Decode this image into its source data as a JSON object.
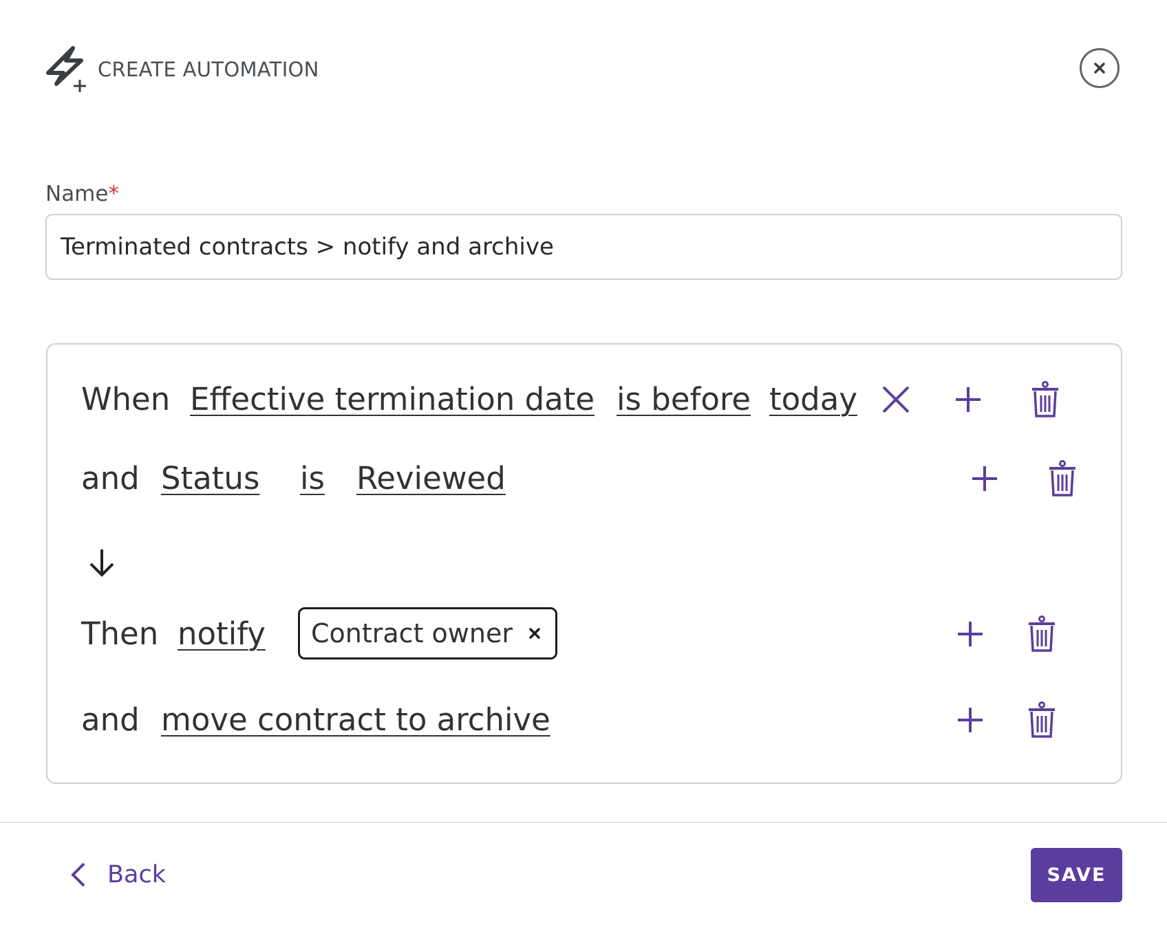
{
  "header": {
    "title": "CREATE AUTOMATION",
    "title_icon": "lightning-plus-icon",
    "close_icon": "close-icon"
  },
  "name_field": {
    "label": "Name",
    "required_mark": "*",
    "value": "Terminated contracts > notify and archive"
  },
  "conditions": [
    {
      "keyword": "When",
      "field": "Effective termination date",
      "operator": "is before",
      "value": "today",
      "has_clear": true
    },
    {
      "keyword": "and",
      "field": "Status",
      "operator": "is",
      "value": "Reviewed",
      "has_clear": false
    }
  ],
  "actions": [
    {
      "keyword": "Then",
      "action": "notify",
      "recipients": [
        "Contract owner"
      ]
    },
    {
      "keyword": "and",
      "action": "move contract to archive"
    }
  ],
  "icons": {
    "add": "plus-icon",
    "delete": "trash-icon",
    "clear": "x-icon",
    "flow": "arrow-down-icon",
    "back": "chevron-left-icon"
  },
  "footer": {
    "back_label": "Back",
    "save_label": "SAVE"
  },
  "colors": {
    "accent": "#5b3d9e",
    "text": "#2f3237",
    "border": "#cdd1d6",
    "required": "#d43a3a"
  }
}
